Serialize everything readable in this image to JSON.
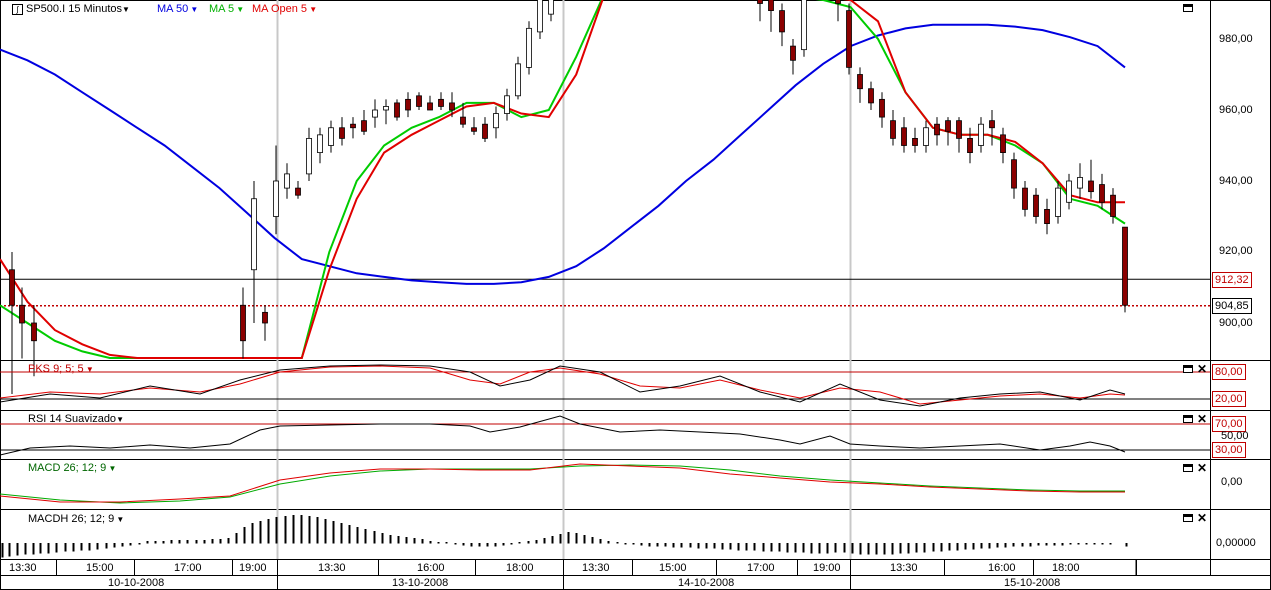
{
  "header": {
    "symbol_label": "SP500.I 15 Minutos",
    "ma50_label": "MA 50",
    "ma5_label": "MA 5",
    "maopen_label": "MA Open  5"
  },
  "colors": {
    "ma50": "#0000e0",
    "ma5": "#00cc00",
    "maopen": "#e00000",
    "grid": "#c8c8c8",
    "candle_down": "#8b0000",
    "candle_up": "#ffffff"
  },
  "price_axis": {
    "ticks": [
      "980,00",
      "960,00",
      "940,00",
      "920,00",
      "900,00"
    ],
    "last_price_tag": "912,32",
    "close_tag": "904,85"
  },
  "pks": {
    "label": "PKS 9; 5; 5",
    "upper_tag": "80,00",
    "lower_tag": "20,00"
  },
  "rsi": {
    "label": "RSI 14 Suavizado",
    "upper_tag": "70,00",
    "mid_tick": "50,00",
    "lower_tag": "30,00"
  },
  "macd": {
    "label": "MACD 26; 12; 9",
    "zero_tick": "0,00"
  },
  "macdh": {
    "label": "MACDH 26; 12; 9",
    "zero_tick": "0,00000"
  },
  "time_axis": {
    "times": [
      "13:30",
      "15:00",
      "17:00",
      "19:00",
      "13:30",
      "16:00",
      "18:00",
      "13:30",
      "15:00",
      "17:00",
      "19:00",
      "13:30",
      "16:00",
      "18:00"
    ],
    "dates": [
      "10-10-2008",
      "13-10-2008",
      "14-10-2008",
      "15-10-2008"
    ]
  },
  "chart_data": {
    "type": "candlestick",
    "title": "SP500.I 15 Minutos",
    "ylim": [
      885,
      992
    ],
    "last_price": 912.32,
    "close_line": 904.85,
    "series": [
      {
        "name": "MA 50",
        "values": [
          977,
          974,
          970,
          965,
          960,
          955,
          950,
          944,
          938,
          931,
          924,
          918,
          916,
          914,
          913,
          912,
          911.5,
          911,
          911,
          911.5,
          913,
          916,
          921,
          927,
          933,
          940,
          946,
          953,
          960,
          967,
          973,
          978,
          981,
          983,
          984,
          984,
          984,
          983.5,
          982.5,
          980.5,
          978,
          972
        ]
      },
      {
        "name": "MA 5",
        "values": [
          905,
          900,
          895,
          892,
          890,
          889,
          888,
          887,
          886,
          886,
          886,
          888,
          920,
          940,
          950,
          955,
          958,
          962,
          962,
          958,
          960,
          975,
          995,
          998,
          999,
          998,
          997,
          996,
          995,
          992,
          991,
          989,
          980,
          965,
          955,
          953,
          953,
          950,
          945,
          935,
          933,
          928
        ]
      },
      {
        "name": "MA Open  5",
        "values": [
          918,
          906,
          898,
          894,
          891,
          889,
          888,
          887,
          886,
          886,
          886,
          887,
          915,
          935,
          948,
          953,
          957,
          961,
          962,
          959,
          958,
          970,
          992,
          997,
          999,
          999,
          998,
          997,
          996,
          994,
          992,
          991,
          985,
          965,
          955,
          953,
          953,
          951,
          945,
          936,
          934,
          934
        ]
      }
    ]
  }
}
